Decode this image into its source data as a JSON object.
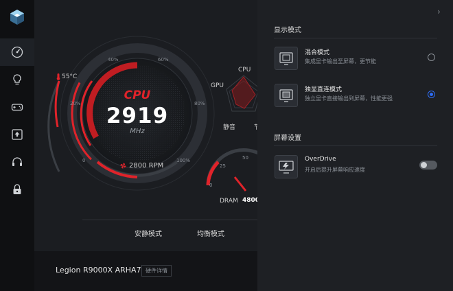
{
  "sidebar": {
    "icons": [
      "app-logo-icon",
      "dashboard-icon",
      "lightbulb-icon",
      "gamepad-icon",
      "upload-icon",
      "headset-icon",
      "lock-icon"
    ]
  },
  "gauge": {
    "title": "CPU",
    "value": "2919",
    "unit": "MHz",
    "fan_rpm": "2800 RPM",
    "temperature": "55°C",
    "ticks": [
      "0",
      "20%",
      "40%",
      "60%",
      "80%",
      "100%"
    ],
    "load_fraction": 0.27,
    "accent": "#e0232a"
  },
  "radar": {
    "labels": {
      "top": "CPU",
      "left": "GPU",
      "bottom": "静音",
      "bottom_right": "节"
    }
  },
  "dram": {
    "label": "DRAM",
    "value": "4800",
    "ticks": [
      "0",
      "25",
      "50"
    ]
  },
  "modes": {
    "quiet": "安静模式",
    "balanced": "均衡模式"
  },
  "bottom": {
    "device_name": "Legion R9000X ARHA7",
    "hardware_details": "硬件详情"
  },
  "panel": {
    "display_mode_title": "显示模式",
    "options": [
      {
        "title": "混合模式",
        "desc": "集成显卡输出至屏幕，更节能",
        "checked": false
      },
      {
        "title": "独显直连模式",
        "desc": "独立显卡直接输出到屏幕，性能更强",
        "checked": true
      }
    ],
    "screen_settings_title": "屏幕设置",
    "overdrive": {
      "title": "OverDrive",
      "desc": "开启后提升屏幕响应速度",
      "enabled": false
    },
    "accent": "#2d6cf5"
  }
}
